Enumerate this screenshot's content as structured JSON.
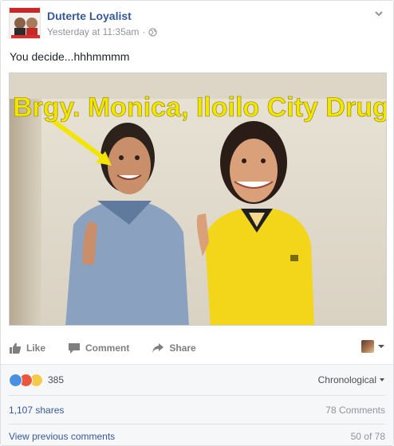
{
  "post": {
    "author": "Duterte Loyalist",
    "timestamp": "Yesterday at 11:35am",
    "timestamp_sep": "·",
    "text": "You decide...hhhmmmm",
    "image_caption": "Brgy. Monica, Iloilo City Drug Lord"
  },
  "actions": {
    "like": "Like",
    "comment": "Comment",
    "share": "Share"
  },
  "engagement": {
    "reaction_count": "385",
    "sort_label": "Chronological",
    "shares": "1,107 shares",
    "comments_count": "78 Comments",
    "view_previous": "View previous comments",
    "paging": "50 of 78"
  },
  "colors": {
    "link_blue": "#365899",
    "caption_yellow": "#f2e600",
    "shirt_yellow": "#f3d51a"
  },
  "icons": [
    "globe-icon",
    "chevron-down-icon",
    "like-icon",
    "comment-icon",
    "share-icon"
  ]
}
